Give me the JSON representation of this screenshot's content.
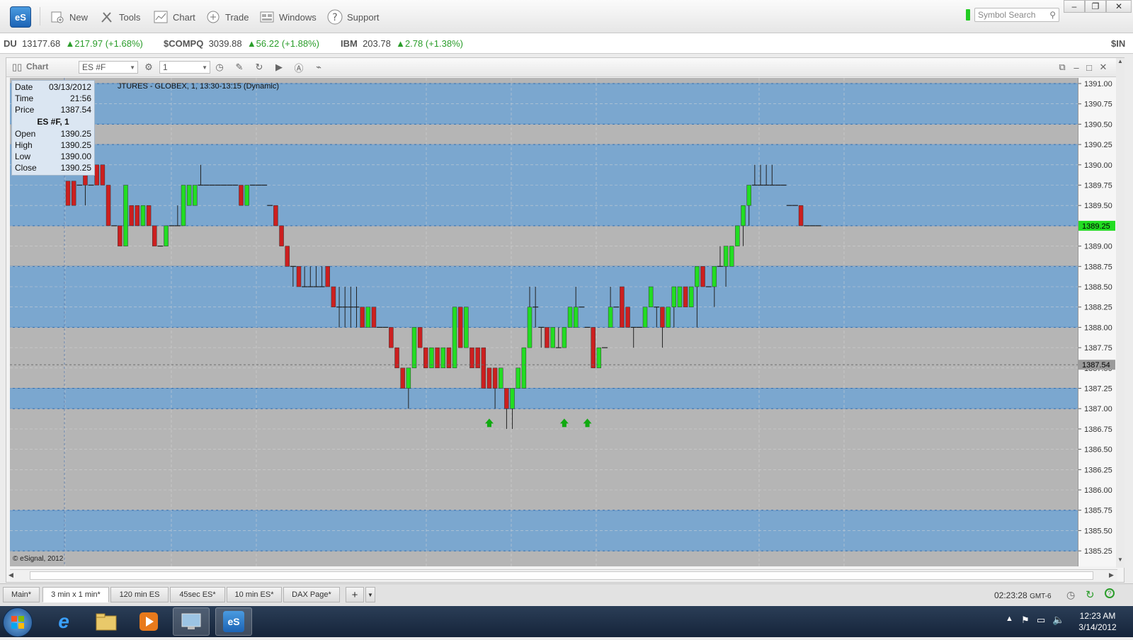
{
  "toolbar": {
    "logo": "eS",
    "new": "New",
    "tools": "Tools",
    "chart": "Chart",
    "trade": "Trade",
    "windows": "Windows",
    "support": "Support",
    "search_placeholder": "Symbol Search"
  },
  "ticker": [
    {
      "sym": "DU",
      "price": "13177.68",
      "change": "▲217.97 (+1.68%)"
    },
    {
      "sym": "$COMPQ",
      "price": "3039.88",
      "change": "▲56.22 (+1.88%)"
    },
    {
      "sym": "IBM",
      "price": "203.78",
      "change": "▲2.78 (+1.38%)"
    },
    {
      "sym": "$IN",
      "price": "",
      "change": ""
    }
  ],
  "chart_window": {
    "title": "Chart",
    "symbol": "ES #F",
    "interval": "1",
    "description": "JTURES - GLOBEX, 1, 13:30-13:15 (Dynamic)",
    "copyright": "© eSignal, 2012"
  },
  "legend": {
    "date_label": "Date",
    "date": "03/13/2012",
    "time_label": "Time",
    "time": "21:56",
    "price_label": "Price",
    "price": "1387.54",
    "title": "ES #F, 1",
    "open_label": "Open",
    "open": "1390.25",
    "high_label": "High",
    "high": "1390.25",
    "low_label": "Low",
    "low": "1390.00",
    "close_label": "Close",
    "close": "1390.25"
  },
  "price_markers": {
    "last": "1389.25",
    "cursor": "1387.54"
  },
  "colors": {
    "up": "#22dd22",
    "down": "#cc1f1f",
    "band": "#7ba7cf",
    "plot_bg": "#b5b5b5",
    "marker": "#11aa11"
  },
  "chart_data": {
    "type": "candlestick",
    "ylim": [
      1385.25,
      1391.0
    ],
    "y_ticks": [
      "1391.00",
      "1390.75",
      "1390.50",
      "1390.25",
      "1390.00",
      "1389.75",
      "1389.50",
      "1389.25",
      "1389.00",
      "1388.75",
      "1388.50",
      "1388.25",
      "1388.00",
      "1387.75",
      "1387.50",
      "1387.25",
      "1387.00",
      "1386.75",
      "1386.50",
      "1386.25",
      "1386.00",
      "1385.75",
      "1385.50",
      "1385.25"
    ],
    "bands": [
      [
        1390.5,
        1391.0
      ],
      [
        1389.25,
        1390.25
      ],
      [
        1388.0,
        1388.75
      ],
      [
        1387.0,
        1387.25
      ],
      [
        1385.25,
        1385.75
      ]
    ],
    "candles": [
      [
        1389.8,
        1389.6,
        1389.6,
        1389.5
      ],
      [
        1389.8,
        1389.6,
        1389.6,
        1389.5
      ],
      [
        1389.75,
        1389.75,
        1389.75,
        1389.75
      ],
      [
        1390.25,
        1390.25,
        1389.5,
        1389.75
      ],
      [
        1389.75,
        1389.75,
        1389.75,
        1389.75
      ],
      [
        1390.0,
        1390.0,
        1389.75,
        1389.75
      ],
      [
        1390.0,
        1390.0,
        1389.75,
        1389.75
      ],
      [
        1389.75,
        1389.75,
        1389.25,
        1389.25
      ],
      [
        1389.25,
        1389.25,
        1389.25,
        1389.25
      ],
      [
        1389.25,
        1389.25,
        1389.0,
        1389.0
      ],
      [
        1389.0,
        1389.75,
        1389.0,
        1389.75
      ],
      [
        1389.5,
        1389.5,
        1389.25,
        1389.25
      ],
      [
        1389.5,
        1389.5,
        1389.25,
        1389.25
      ],
      [
        1389.25,
        1389.5,
        1389.25,
        1389.5
      ],
      [
        1389.5,
        1389.5,
        1389.25,
        1389.25
      ],
      [
        1389.25,
        1389.25,
        1389.0,
        1389.0
      ],
      [
        1389.0,
        1389.0,
        1389.0,
        1389.0
      ],
      [
        1389.0,
        1389.25,
        1389.0,
        1389.25
      ],
      [
        1389.25,
        1389.25,
        1389.25,
        1389.25
      ],
      [
        1389.25,
        1389.5,
        1389.25,
        1389.25
      ],
      [
        1389.25,
        1389.75,
        1389.25,
        1389.75
      ],
      [
        1389.5,
        1389.75,
        1389.5,
        1389.75
      ],
      [
        1389.5,
        1389.75,
        1389.5,
        1389.75
      ],
      [
        1389.75,
        1390.0,
        1389.75,
        1389.75
      ],
      [
        1389.75,
        1389.75,
        1389.75,
        1389.75
      ],
      [
        1389.75,
        1389.75,
        1389.75,
        1389.75
      ],
      [
        1389.75,
        1389.75,
        1389.75,
        1389.75
      ],
      [
        1389.75,
        1389.75,
        1389.75,
        1389.75
      ],
      [
        1389.75,
        1389.75,
        1389.75,
        1389.75
      ],
      [
        1389.75,
        1389.75,
        1389.75,
        1389.75
      ],
      [
        1389.75,
        1389.75,
        1389.5,
        1389.5
      ],
      [
        1389.5,
        1389.75,
        1389.5,
        1389.75
      ],
      [
        1389.75,
        1389.75,
        1389.75,
        1389.75
      ],
      [
        1389.75,
        1389.75,
        1389.75,
        1389.75
      ],
      [
        1389.75,
        1389.75,
        1389.75,
        1389.75
      ],
      [
        1389.5,
        1389.5,
        1389.5,
        1389.5
      ],
      [
        1389.5,
        1389.5,
        1389.25,
        1389.25
      ],
      [
        1389.25,
        1389.25,
        1389.0,
        1389.0
      ],
      [
        1389.0,
        1389.0,
        1388.75,
        1388.75
      ],
      [
        1388.75,
        1388.75,
        1388.5,
        1388.75
      ],
      [
        1388.75,
        1388.75,
        1388.5,
        1388.5
      ],
      [
        1388.5,
        1388.75,
        1388.5,
        1388.5
      ],
      [
        1388.5,
        1388.75,
        1388.5,
        1388.5
      ],
      [
        1388.5,
        1388.75,
        1388.5,
        1388.5
      ],
      [
        1388.5,
        1388.75,
        1388.5,
        1388.5
      ],
      [
        1388.75,
        1388.75,
        1388.5,
        1388.5
      ],
      [
        1388.5,
        1388.5,
        1388.25,
        1388.25
      ],
      [
        1388.25,
        1388.5,
        1388.0,
        1388.25
      ],
      [
        1388.25,
        1388.5,
        1388.0,
        1388.25
      ],
      [
        1388.25,
        1388.5,
        1388.0,
        1388.25
      ],
      [
        1388.25,
        1388.5,
        1388.0,
        1388.25
      ],
      [
        1388.25,
        1388.25,
        1388.0,
        1388.0
      ],
      [
        1388.0,
        1388.25,
        1388.0,
        1388.25
      ],
      [
        1388.25,
        1388.25,
        1388.0,
        1388.0
      ],
      [
        1388.0,
        1388.0,
        1388.0,
        1388.0
      ],
      [
        1388.0,
        1388.0,
        1388.0,
        1388.0
      ],
      [
        1388.0,
        1388.0,
        1387.75,
        1387.75
      ],
      [
        1387.75,
        1387.75,
        1387.5,
        1387.5
      ],
      [
        1387.5,
        1387.5,
        1387.25,
        1387.25
      ],
      [
        1387.25,
        1387.5,
        1387.0,
        1387.5
      ],
      [
        1387.5,
        1388.0,
        1387.5,
        1388.0
      ],
      [
        1388.0,
        1388.0,
        1387.75,
        1387.75
      ],
      [
        1387.75,
        1387.75,
        1387.5,
        1387.5
      ],
      [
        1387.5,
        1387.75,
        1387.5,
        1387.75
      ],
      [
        1387.75,
        1387.75,
        1387.5,
        1387.5
      ],
      [
        1387.5,
        1387.75,
        1387.5,
        1387.75
      ],
      [
        1387.75,
        1387.75,
        1387.5,
        1387.5
      ],
      [
        1387.5,
        1388.25,
        1387.5,
        1388.25
      ],
      [
        1388.25,
        1388.25,
        1387.75,
        1387.75
      ],
      [
        1387.75,
        1388.25,
        1387.75,
        1388.25
      ],
      [
        1387.75,
        1387.75,
        1387.5,
        1387.5
      ],
      [
        1387.75,
        1387.75,
        1387.5,
        1387.5
      ],
      [
        1387.75,
        1387.75,
        1387.25,
        1387.25
      ],
      [
        1387.5,
        1387.5,
        1387.25,
        1387.25
      ],
      [
        1387.5,
        1387.5,
        1387.0,
        1387.25
      ],
      [
        1387.25,
        1387.5,
        1387.25,
        1387.5
      ],
      [
        1387.25,
        1387.25,
        1386.75,
        1387.0
      ],
      [
        1387.0,
        1387.25,
        1386.75,
        1387.25
      ],
      [
        1387.25,
        1387.5,
        1387.25,
        1387.5
      ],
      [
        1387.25,
        1387.75,
        1387.25,
        1387.75
      ],
      [
        1387.75,
        1388.5,
        1387.75,
        1388.25
      ],
      [
        1388.25,
        1388.5,
        1388.0,
        1388.25
      ],
      [
        1388.0,
        1388.0,
        1387.75,
        1388.0
      ],
      [
        1388.0,
        1388.0,
        1387.75,
        1387.75
      ],
      [
        1387.75,
        1388.0,
        1387.75,
        1388.0
      ],
      [
        1387.75,
        1388.0,
        1387.75,
        1387.75
      ],
      [
        1387.75,
        1388.0,
        1387.75,
        1388.0
      ],
      [
        1388.0,
        1388.25,
        1388.0,
        1388.25
      ],
      [
        1388.0,
        1388.5,
        1388.0,
        1388.25
      ],
      [
        1388.25,
        1388.25,
        1388.25,
        1388.25
      ],
      [
        1388.0,
        1388.0,
        1388.0,
        1388.0
      ],
      [
        1388.0,
        1388.0,
        1387.5,
        1387.5
      ],
      [
        1387.5,
        1387.75,
        1387.5,
        1387.75
      ],
      [
        1387.75,
        1387.75,
        1387.75,
        1387.75
      ],
      [
        1388.0,
        1388.5,
        1388.0,
        1388.25
      ],
      [
        1388.25,
        1388.25,
        1388.25,
        1388.25
      ],
      [
        1388.5,
        1388.5,
        1388.0,
        1388.0
      ],
      [
        1388.25,
        1388.25,
        1388.0,
        1388.0
      ],
      [
        1388.0,
        1388.0,
        1387.75,
        1388.0
      ],
      [
        1388.0,
        1388.0,
        1388.0,
        1388.0
      ],
      [
        1388.0,
        1388.25,
        1388.0,
        1388.25
      ],
      [
        1388.25,
        1388.5,
        1388.25,
        1388.5
      ],
      [
        1388.25,
        1388.25,
        1388.0,
        1388.25
      ],
      [
        1388.25,
        1388.25,
        1387.75,
        1388.0
      ],
      [
        1388.0,
        1388.25,
        1388.0,
        1388.25
      ],
      [
        1388.25,
        1388.5,
        1388.0,
        1388.5
      ],
      [
        1388.25,
        1388.5,
        1388.25,
        1388.5
      ],
      [
        1388.5,
        1388.5,
        1388.25,
        1388.25
      ],
      [
        1388.25,
        1388.5,
        1388.25,
        1388.5
      ],
      [
        1388.5,
        1388.75,
        1388.0,
        1388.75
      ],
      [
        1388.75,
        1388.75,
        1388.5,
        1388.5
      ],
      [
        1388.5,
        1388.5,
        1388.5,
        1388.5
      ],
      [
        1388.5,
        1388.75,
        1388.25,
        1388.75
      ],
      [
        1388.75,
        1389.0,
        1388.75,
        1388.75
      ],
      [
        1388.75,
        1388.75,
        1388.5,
        1389.0
      ],
      [
        1388.75,
        1389.0,
        1388.75,
        1389.0
      ],
      [
        1389.0,
        1389.25,
        1389.0,
        1389.25
      ],
      [
        1389.25,
        1389.5,
        1389.0,
        1389.5
      ],
      [
        1389.5,
        1389.75,
        1389.25,
        1389.75
      ],
      [
        1389.75,
        1390.0,
        1389.75,
        1389.75
      ],
      [
        1389.75,
        1390.0,
        1389.75,
        1389.75
      ],
      [
        1389.75,
        1390.0,
        1389.75,
        1389.75
      ],
      [
        1389.75,
        1390.0,
        1389.75,
        1389.75
      ],
      [
        1389.75,
        1389.75,
        1389.75,
        1389.75
      ],
      [
        1389.75,
        1389.75,
        1389.75,
        1389.75
      ],
      [
        1389.5,
        1389.5,
        1389.5,
        1389.5
      ],
      [
        1389.5,
        1389.5,
        1389.5,
        1389.5
      ],
      [
        1389.5,
        1389.5,
        1389.25,
        1389.25
      ],
      [
        1389.25,
        1389.25,
        1389.25,
        1389.25
      ],
      [
        1389.25,
        1389.25,
        1389.25,
        1389.25
      ],
      [
        1389.25,
        1389.25,
        1389.25,
        1389.25
      ]
    ],
    "up_markers": [
      1387.0,
      1387.0,
      1387.0
    ]
  },
  "tabs": [
    "Main*",
    "3 min x 1 min*",
    "120 min ES",
    "45sec ES*",
    "10 min ES*",
    "DAX Page*",
    "+"
  ],
  "active_tab": "3 min x 1 min*",
  "status": {
    "time": "02:23:28",
    "tz": "GMT-6"
  },
  "taskbar": {
    "time": "12:23 AM",
    "date": "3/14/2012"
  }
}
